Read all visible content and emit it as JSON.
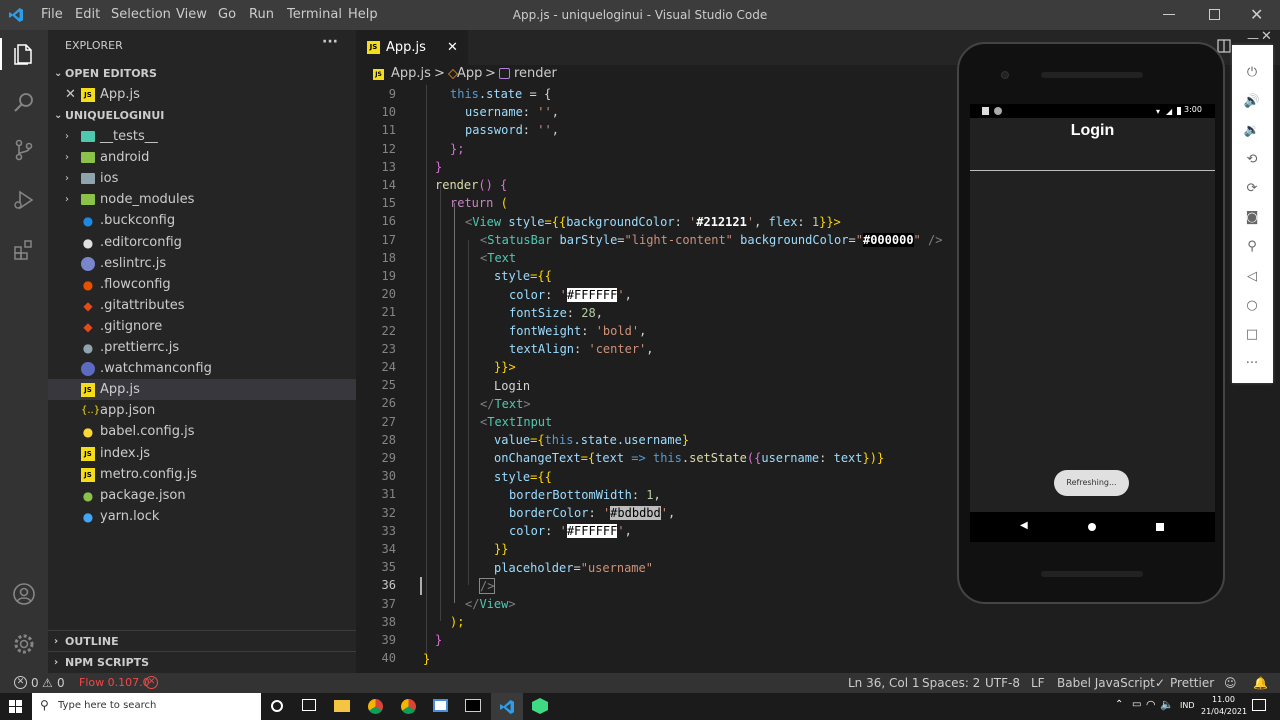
{
  "titlebar": {
    "menus": [
      "File",
      "Edit",
      "Selection",
      "View",
      "Go",
      "Run",
      "Terminal",
      "Help"
    ],
    "window_title": "App.js - uniqueloginui - Visual Studio Code",
    "controls": [
      "minimize-icon",
      "restore-icon",
      "close-icon"
    ]
  },
  "explorer": {
    "title": "EXPLORER",
    "more": "···",
    "open_editors_label": "OPEN EDITORS",
    "open_editor_file": "App.js",
    "folder_label": "UNIQUELOGINUI",
    "items": [
      {
        "label": "__tests__",
        "icon": "folder-icon",
        "color": "#4ec9b0"
      },
      {
        "label": "android",
        "icon": "folder-icon",
        "color": "#8bc34a"
      },
      {
        "label": "ios",
        "icon": "folder-icon",
        "color": "#90a4ae"
      },
      {
        "label": "node_modules",
        "icon": "folder-icon",
        "color": "#8bc34a"
      },
      {
        "label": ".buckconfig",
        "icon": "buck-icon",
        "color": "#1e88e5"
      },
      {
        "label": ".editorconfig",
        "icon": "editorconfig-icon",
        "color": "#e0e0e0"
      },
      {
        "label": ".eslintrc.js",
        "icon": "eslint-icon",
        "color": "#7986cb"
      },
      {
        "label": ".flowconfig",
        "icon": "flow-icon",
        "color": "#e65100"
      },
      {
        "label": ".gitattributes",
        "icon": "git-icon",
        "color": "#e64a19"
      },
      {
        "label": ".gitignore",
        "icon": "git-icon",
        "color": "#e64a19"
      },
      {
        "label": ".prettierrc.js",
        "icon": "prettier-icon",
        "color": "#90a4ae"
      },
      {
        "label": ".watchmanconfig",
        "icon": "watchman-icon",
        "color": "#5c6bc0"
      },
      {
        "label": "App.js",
        "icon": "js-icon",
        "color": "#f5de19"
      },
      {
        "label": "app.json",
        "icon": "json-icon",
        "color": "#f5de19"
      },
      {
        "label": "babel.config.js",
        "icon": "babel-icon",
        "color": "#fdd835"
      },
      {
        "label": "index.js",
        "icon": "js-icon",
        "color": "#f5de19"
      },
      {
        "label": "metro.config.js",
        "icon": "js-icon",
        "color": "#f5de19"
      },
      {
        "label": "package.json",
        "icon": "npm-icon",
        "color": "#8bc34a"
      },
      {
        "label": "yarn.lock",
        "icon": "yarn-icon",
        "color": "#42a5f5"
      }
    ],
    "outline_label": "OUTLINE",
    "npm_scripts_label": "NPM SCRIPTS"
  },
  "tab": {
    "label": "App.js",
    "js_badge": "JS"
  },
  "breadcrumbs": {
    "file": "App.js",
    "sep": ">",
    "component": "App",
    "method": "render"
  },
  "editor": {
    "lines": [
      {
        "n": "9"
      },
      {
        "n": "10"
      },
      {
        "n": "11"
      },
      {
        "n": "12"
      },
      {
        "n": "13"
      },
      {
        "n": "14"
      },
      {
        "n": "15"
      },
      {
        "n": "16"
      },
      {
        "n": "17"
      },
      {
        "n": "18"
      },
      {
        "n": "19"
      },
      {
        "n": "20"
      },
      {
        "n": "21"
      },
      {
        "n": "22"
      },
      {
        "n": "23"
      },
      {
        "n": "24"
      },
      {
        "n": "25"
      },
      {
        "n": "26"
      },
      {
        "n": "27"
      },
      {
        "n": "28"
      },
      {
        "n": "29"
      },
      {
        "n": "30"
      },
      {
        "n": "31"
      },
      {
        "n": "32"
      },
      {
        "n": "33"
      },
      {
        "n": "34"
      },
      {
        "n": "35"
      },
      {
        "n": "36"
      },
      {
        "n": "37"
      },
      {
        "n": "38"
      },
      {
        "n": "39"
      },
      {
        "n": "40"
      }
    ],
    "code": {
      "l9a": "this",
      "l9b": ".state",
      "l9c": " = {",
      "l10a": "username",
      "l10b": ": ",
      "l10c": "''",
      "l10d": ",",
      "l11a": "password",
      "l11b": ": ",
      "l11c": "''",
      "l11d": ",",
      "l12": "};",
      "l13": "}",
      "l14a": "render",
      "l14b": "() {",
      "l15a": "return",
      "l15b": " (",
      "l16a": "<",
      "l16b": "View",
      "l16c": " style",
      "l16d": "={{",
      "l16e": "backgroundColor",
      "l16f": ": ",
      "l16g": "'",
      "l16h": "#212121",
      "l16i": "'",
      "l16j": ", ",
      "l16k": "flex",
      "l16l": ": ",
      "l16m": "1",
      "l16n": "}}>",
      "l17a": "<",
      "l17b": "StatusBar",
      "l17c": " barStyle",
      "l17d": "=",
      "l17e": "\"light-content\"",
      "l17f": " backgroundColor",
      "l17g": "=",
      "l17h": "\"",
      "l17i": "#000000",
      "l17j": "\"",
      "l17k": " />",
      "l18a": "<",
      "l18b": "Text",
      "l19a": "style",
      "l19b": "={{",
      "l20a": "color",
      "l20b": ": ",
      "l20c": "'",
      "l20d": "#FFFFFF",
      "l20e": "'",
      ",l20f": ",",
      "l21a": "fontSize",
      "l21b": ": ",
      "l21c": "28",
      "l21d": ",",
      "l22a": "fontWeight",
      "l22b": ": ",
      "l22c": "'bold'",
      "l22d": ",",
      "l23a": "textAlign",
      "l23b": ": ",
      "l23c": "'center'",
      "l23d": ",",
      "l24": "}}>",
      "l25": "Login",
      "l26a": "</",
      "l26b": "Text",
      "l26c": ">",
      "l27a": "<",
      "l27b": "TextInput",
      "l28a": "value",
      "l28b": "={",
      "l28c": "this",
      "l28d": ".state.",
      "l28e": "username",
      "l28f": "}",
      "l29a": "onChangeText",
      "l29b": "={",
      "l29c": "text",
      "l29d": " => ",
      "l29e": "this",
      "l29f": ".",
      "l29g": "setState",
      "l29h": "({",
      "l29i": "username",
      "l29j": ": ",
      "l29k": "text",
      "l29l": "})}",
      "l30a": "style",
      "l30b": "={{",
      "l31a": "borderBottomWidth",
      "l31b": ": ",
      "l31c": "1",
      "l31d": ",",
      "l32a": "borderColor",
      "l32b": ": ",
      "l32c": "'",
      "l32d": "#bdbdbd",
      "l32e": "'",
      "l32f": ",",
      "l33a": "color",
      "l33b": ": ",
      "l33c": "'",
      "l33d": "#FFFFFF",
      "l33e": "'",
      "l33f": ",",
      "l34": "}}",
      "l35a": "placeholder",
      "l35b": "=",
      "l35c": "\"username\"",
      "l36": "/>",
      "l37a": "</",
      "l37b": "View",
      "l37c": ">",
      "l38": ");",
      "l39": "}",
      "l40": "}"
    }
  },
  "statusbar": {
    "errors": "0",
    "warnings": "0",
    "flow": "Flow 0.107.0",
    "position": "Ln 36, Col 1",
    "spaces": "Spaces: 2",
    "encoding": "UTF-8",
    "eol": "LF",
    "language": "Babel JavaScript",
    "prettier": "Prettier"
  },
  "emulator": {
    "status_time": "3:00",
    "app_title": "Login",
    "toast": "Refreshing..."
  },
  "taskbar": {
    "search_placeholder": "Type here to search",
    "lang": "IND",
    "time": "11.00",
    "date": "21/04/2021"
  },
  "colors": {
    "accent": "#007acc",
    "js": "#f5de19",
    "flow_error": "#f44747"
  }
}
